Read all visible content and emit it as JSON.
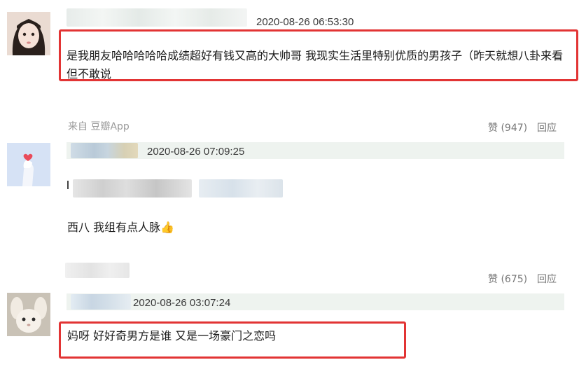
{
  "comments": [
    {
      "timestamp": "2020-08-26 06:53:30",
      "text": "是我朋友哈哈哈哈哈成绩超好有钱又高的大帅哥 我现实生活里特别优质的男孩子（昨天就想八卦来看但不敢说",
      "source": "来自 豆瓣App",
      "like_label": "赞 (947)",
      "reply_label": "回应"
    },
    {
      "timestamp": "2020-08-26 07:09:25",
      "text": "西八 我组有点人脉👍",
      "like_label": "赞 (675)",
      "reply_label": "回应"
    },
    {
      "timestamp": "2020-08-26 03:07:24",
      "text": "妈呀 好好奇男方是谁 又是一场豪门之恋吗"
    }
  ],
  "colors": {
    "highlight": "#e23434",
    "meta_bar": "#eef3ef"
  }
}
